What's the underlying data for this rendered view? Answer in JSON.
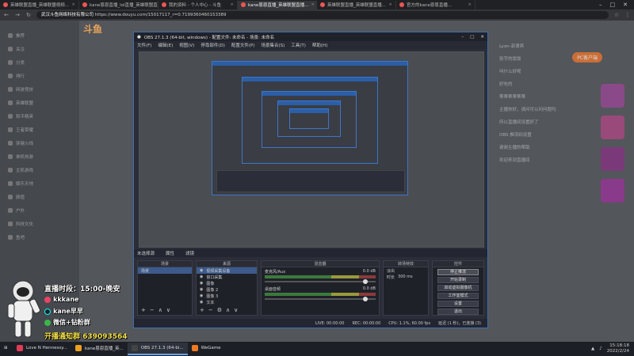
{
  "browser": {
    "tabs": [
      {
        "label": "英雄联盟直播_英雄联盟视频...",
        "active": false
      },
      {
        "label": "kane恩恩直播_lol直播_英雄联盟直播...",
        "active": false
      },
      {
        "label": "我的资料 - 个人中心 - 斗鱼",
        "active": false
      },
      {
        "label": "kane恩恩直播_英雄联盟直播...",
        "active": true
      },
      {
        "label": "英雄联盟直播_英雄联盟直播...",
        "active": false
      },
      {
        "label": "官方的kane恩恩直播...",
        "active": false
      }
    ],
    "url_site": "武汉斗鱼网络科技有限公司",
    "url": "https://www.douyu.com/15017117_r=0.7199360460153389"
  },
  "douyu": {
    "logo": "斗鱼",
    "pc_button": "PC客户端",
    "sidebar_items": [
      "推荐",
      "关注",
      "分类",
      "排行",
      "网游竞技",
      "英雄联盟",
      "和平精英",
      "王者荣耀",
      "穿越火线",
      "单机热游",
      "主机游戏",
      "娱乐天地",
      "颜值",
      "户外",
      "科技文化",
      "鱼吧"
    ],
    "chat_lines": [
      "Lyon-菲律宾",
      "张宇的饭饭",
      "叫什么好呢",
      "好吃的",
      "蒂蒂蒂蒂蒂蒂",
      "主播你好，请问可以问问题吗",
      "所以直播间设置好了",
      "OBS 推流码设置",
      "谢谢主播的帮助",
      "欢迎来到直播间"
    ]
  },
  "overlay": {
    "time": "直播时段：15:00-晚安",
    "lines": [
      "kkkane",
      "kane早早",
      "微信+钻粉群"
    ],
    "qq": "开播通知群 639093564"
  },
  "obs": {
    "title": "OBS 27.1.3 (64-bit, windows) - 配置文件: 未命名 - 场景: 未命名",
    "menu": [
      "文件(F)",
      "编辑(E)",
      "视图(V)",
      "停靠部件(D)",
      "配置文件(P)",
      "场景集合(S)",
      "工具(T)",
      "帮助(H)"
    ],
    "dock_header": [
      "未选择源",
      "属性",
      "滤镜"
    ],
    "scenes": {
      "header": "场景",
      "items": [
        "场景"
      ]
    },
    "sources": {
      "header": "来源",
      "items": [
        "视频采集设备",
        "窗口采集",
        "图像",
        "图像 2",
        "图像 3",
        "文本"
      ]
    },
    "mixer": {
      "header": "混音器",
      "channels": [
        {
          "name": "麦克风/Aux",
          "db": "0.0 dB"
        },
        {
          "name": "桌面音频",
          "db": "0.0 dB"
        }
      ]
    },
    "transitions": {
      "header": "转场特效",
      "type": "淡出",
      "duration_label": "时长",
      "duration": "300 ms"
    },
    "controls": {
      "header": "控件",
      "buttons": [
        "停止推流",
        "开始录制",
        "启动虚拟摄像机",
        "工作室模式",
        "设置",
        "退出"
      ]
    },
    "status": [
      "LIVE: 00:00:00",
      "REC: 00:00:00",
      "CPU: 1.1%, 60.00 fps",
      "延迟 (1 秒)，已连接 (3)"
    ]
  },
  "taskbar": {
    "apps": [
      {
        "label": "Love N Hennessy...",
        "color": "#e33a55",
        "active": false
      },
      {
        "label": "kane恩恩直播_英...",
        "color": "#f0a020",
        "active": false
      },
      {
        "label": "OBS 27.1.3 (64-bi...",
        "color": "#444444",
        "active": true
      },
      {
        "label": "WeGame",
        "color": "#f07a20",
        "active": false
      }
    ],
    "time": "15:18:18",
    "date": "2022/2/24"
  }
}
